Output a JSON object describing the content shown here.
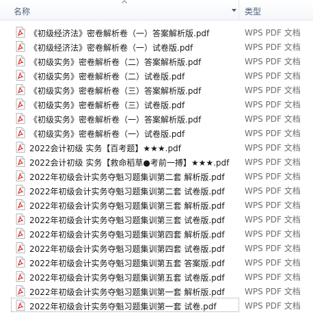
{
  "header": {
    "name_label": "名称",
    "type_label": "类型"
  },
  "files": [
    {
      "name": "《初级经济法》密卷解析卷（一）答案解析版.pdf",
      "type": "WPS PDF 文档"
    },
    {
      "name": "《初级经济法》密卷解析卷（一）试卷版.pdf",
      "type": "WPS PDF 文档"
    },
    {
      "name": "《初级实务》密卷解析卷（二）答案解析版.pdf",
      "type": "WPS PDF 文档"
    },
    {
      "name": "《初级实务》密卷解析卷（二）试卷版.pdf",
      "type": "WPS PDF 文档"
    },
    {
      "name": "《初级实务》密卷解析卷（三）答案解析版.pdf",
      "type": "WPS PDF 文档"
    },
    {
      "name": "《初级实务》密卷解析卷（三）试卷版.pdf",
      "type": "WPS PDF 文档"
    },
    {
      "name": "《初级实务》密卷解析卷（一）答案解析版.pdf",
      "type": "WPS PDF 文档"
    },
    {
      "name": "《初级实务》密卷解析卷（一）试卷版.pdf",
      "type": "WPS PDF 文档"
    },
    {
      "name": "2022会计初级 实务【百考题】★★★.pdf",
      "type": "WPS PDF 文档"
    },
    {
      "name": "2022会计初级 实务【救命稻草●考前一搏】★★★.pdf",
      "type": "WPS PDF 文档"
    },
    {
      "name": "2022年初级会计实务夺魁习题集训第二套 解析版.pdf",
      "type": "WPS PDF 文档"
    },
    {
      "name": "2022年初级会计实务夺魁习题集训第二套 试卷版.pdf",
      "type": "WPS PDF 文档"
    },
    {
      "name": "2022年初级会计实务夺魁习题集训第三套 解析版.pdf",
      "type": "WPS PDF 文档"
    },
    {
      "name": "2022年初级会计实务夺魁习题集训第三套 试卷版.pdf",
      "type": "WPS PDF 文档"
    },
    {
      "name": "2022年初级会计实务夺魁习题集训第四套 解析版.pdf",
      "type": "WPS PDF 文档"
    },
    {
      "name": "2022年初级会计实务夺魁习题集训第四套 试卷版.pdf",
      "type": "WPS PDF 文档"
    },
    {
      "name": "2022年初级会计实务夺魁习题集训第五套 答案版.pdf",
      "type": "WPS PDF 文档"
    },
    {
      "name": "2022年初级会计实务夺魁习题集训第五套 试卷版.pdf",
      "type": "WPS PDF 文档"
    },
    {
      "name": "2022年初级会计实务夺魁习题集训第一套 解析版.pdf",
      "type": "WPS PDF 文档"
    },
    {
      "name": "2022年初级会计实务夺魁习题集训第一套 试卷.pdf",
      "type": "WPS PDF 文档"
    }
  ],
  "colors": {
    "header_text": "#4c607a",
    "pdf_icon": "#d9332b",
    "type_text": "#6d6d6d"
  },
  "icons": {
    "file_icon": "pdf-file-icon",
    "sort_indicator": "sort-up-arrow-icon",
    "column_menu": "chevron-down-icon"
  }
}
